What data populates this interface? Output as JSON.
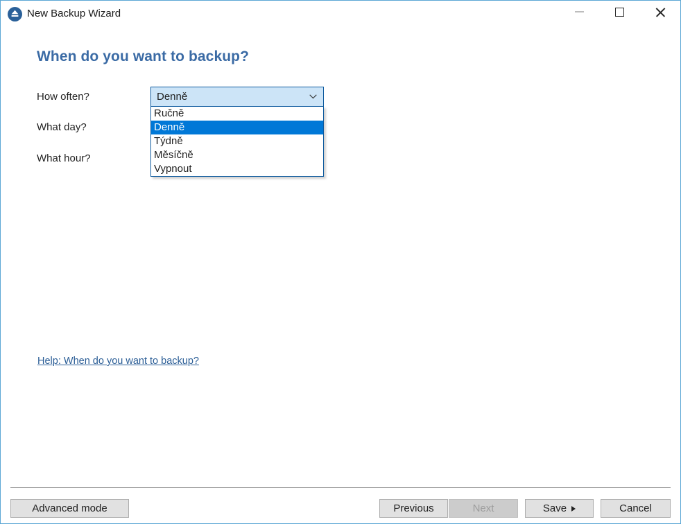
{
  "window": {
    "title": "New Backup Wizard",
    "app_icon": "eject-disc-icon",
    "minimize_label": "Minimize",
    "maximize_label": "Maximize",
    "close_label": "Close",
    "border_color": "#5ba7d4"
  },
  "help": {
    "button_glyph": "?",
    "link_text": "Help: When do you want to backup?"
  },
  "page": {
    "heading": "When do you want to backup?",
    "heading_color": "#3b6ba5"
  },
  "form": {
    "fields": [
      {
        "label": "How often?"
      },
      {
        "label": "What day?"
      },
      {
        "label": "What hour?"
      }
    ],
    "how_often": {
      "label": "How often?",
      "value": "Denně",
      "expanded": true,
      "highlight_color": "#0078d7",
      "field_background": "#cce4f7",
      "border_color": "#0d5a9e",
      "options": [
        {
          "label": "Ručně",
          "selected": false
        },
        {
          "label": "Denně",
          "selected": true
        },
        {
          "label": "Týdně",
          "selected": false
        },
        {
          "label": "Měsíčně",
          "selected": false
        },
        {
          "label": "Vypnout",
          "selected": false
        }
      ]
    }
  },
  "footer": {
    "advanced_label": "Advanced mode",
    "previous_label": "Previous",
    "next_label": "Next",
    "next_disabled": true,
    "save_label": "Save",
    "save_has_menu": true,
    "cancel_label": "Cancel"
  }
}
